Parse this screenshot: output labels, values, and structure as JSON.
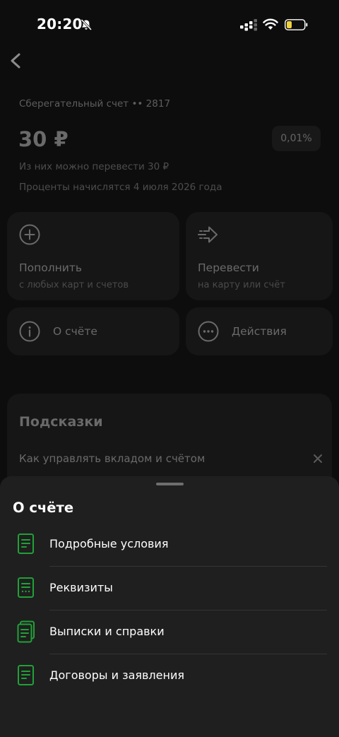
{
  "status_bar": {
    "time": "20:20"
  },
  "account": {
    "name": "Сберегательный счет •• 2817",
    "balance": "30 ₽",
    "rate": "0,01%",
    "transferable": "Из них можно перевести 30 ₽",
    "interest_date": "Проценты начислятся 4 июля 2026 года"
  },
  "actions": {
    "topup": {
      "title": "Пополнить",
      "subtitle": "с любых карт и счетов",
      "icon": "plus-circle-icon"
    },
    "transfer": {
      "title": "Перевести",
      "subtitle": "на карту или счёт",
      "icon": "arrow-right-icon"
    },
    "about": {
      "title": "О счёте",
      "icon": "info-icon"
    },
    "more": {
      "title": "Действия",
      "icon": "more-icon"
    }
  },
  "tips": {
    "title": "Подсказки",
    "item": "Как управлять вкладом и счётом"
  },
  "sheet": {
    "title": "О счёте",
    "items": [
      {
        "label": "Подробные условия",
        "icon": "document-icon"
      },
      {
        "label": "Реквизиты",
        "icon": "document-details-icon"
      },
      {
        "label": "Выписки и справки",
        "icon": "documents-stack-icon"
      },
      {
        "label": "Договоры и заявления",
        "icon": "document-icon"
      }
    ]
  },
  "colors": {
    "accent": "#21A038",
    "sheet_background": "#1f1f1f",
    "card_background": "#161616"
  }
}
